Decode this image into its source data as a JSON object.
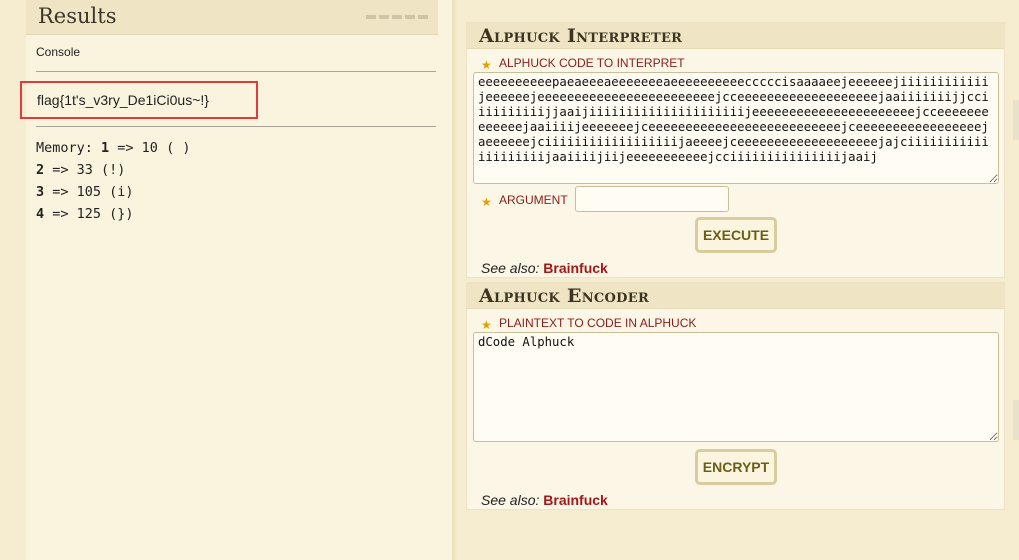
{
  "results": {
    "title": "Results",
    "console_label": "Console",
    "flag": "flag{1t's_v3ry_De1iCi0us~!}",
    "memory_prefix": "Memory: ",
    "memory": [
      {
        "index": "1",
        "value": " => 10 ( )"
      },
      {
        "index": "2",
        "value": " => 33 (!)"
      },
      {
        "index": "3",
        "value": " => 105 (i)"
      },
      {
        "index": "4",
        "value": " => 125 (})"
      }
    ]
  },
  "interpreter": {
    "title": "Alphuck Interpreter",
    "code_label": "ALPHUCK CODE TO INTERPRET",
    "code": "eeeeeeeeeepaeaeeeaeeeeeeeaeeeeeeeeeecccccisaaaaeejeeeeeejiiiiiiiiiiiijeeeeeejeeeeeeeeeeeeeeeeeeeeeeeejcceeeeeeeeeeeeeeeeeeejaaiiiiiiijjcciiiiiiiiiijjaaijiiiiiiiiiiiiiiiiiiiiijeeeeeeeeeeeeeeeeeeeeeejcceeeeeeeeeeeeejaaiiiijeeeeeeejceeeeeeeeeeeeeeeeeeeeeeeeeejceeeeeeeeeeeeeeeeejaeeeeeejciiiiiiiiiiiiiiiiiijaeeeejceeeeeeeeeeeeeeeeeeejajciiiiiiiiiiiiiiiiiiiijaaiiiijiijeeeeeeeeeeejcciiiiiiiiiiiiiiijaaij",
    "argument_label": "ARGUMENT",
    "argument_value": "",
    "execute_label": "EXECUTE",
    "see_also_prefix": "See also: ",
    "see_also_link": "Brainfuck"
  },
  "encoder": {
    "title": "Alphuck Encoder",
    "plaintext_label": "PLAINTEXT TO CODE IN ALPHUCK",
    "plaintext": "dCode Alphuck",
    "encrypt_label": "ENCRYPT",
    "see_also_prefix": "See also: ",
    "see_also_link": "Brainfuck"
  },
  "colors": {
    "accent_red": "#a01818",
    "highlight_box": "#e03c3c",
    "button_text": "#6a5e18"
  }
}
